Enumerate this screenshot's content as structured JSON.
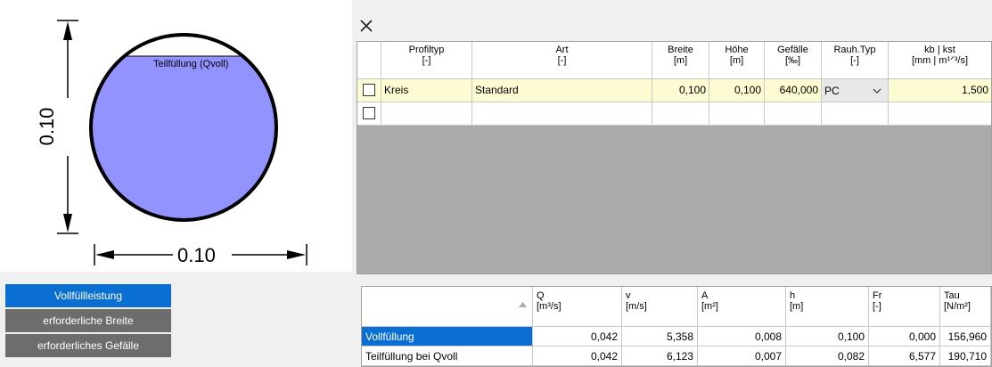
{
  "drawing": {
    "fill_label": "Teilfüllung (Qvoll)",
    "dim_vertical": "0.10",
    "dim_horizontal": "0.10",
    "fill_color": "#9393ff"
  },
  "menu": [
    {
      "label": "Vollfüllleistung",
      "active": true
    },
    {
      "label": "erforderliche Breite",
      "active": false
    },
    {
      "label": "erforderliches Gefälle",
      "active": false
    }
  ],
  "profile_table": {
    "headers": [
      {
        "label": "Profiltyp",
        "unit": "[-]"
      },
      {
        "label": "Art",
        "unit": "[-]"
      },
      {
        "label": "Breite",
        "unit": "[m]"
      },
      {
        "label": "Höhe",
        "unit": "[m]"
      },
      {
        "label": "Gefälle",
        "unit": "[‰]"
      },
      {
        "label": "Rauh.Typ",
        "unit": "[-]"
      },
      {
        "label": "kb | kst",
        "unit": "[mm | m¹ᐟ³/s]"
      }
    ],
    "row": {
      "profiltyp": "Kreis",
      "art": "Standard",
      "breite": "0,100",
      "hoehe": "0,100",
      "gefaelle": "640,000",
      "rauh_typ": "PC",
      "kb_kst": "1,500"
    }
  },
  "result_table": {
    "headers": [
      {
        "label": "Q",
        "unit": "[m³/s]"
      },
      {
        "label": "v",
        "unit": "[m/s]"
      },
      {
        "label": "A",
        "unit": "[m²]"
      },
      {
        "label": "h",
        "unit": "[m]"
      },
      {
        "label": "Fr",
        "unit": "[-]"
      },
      {
        "label": "Tau",
        "unit": "[N/m²]"
      }
    ],
    "rows": [
      {
        "label": "Vollfüllung",
        "values": [
          "0,042",
          "5,358",
          "0,008",
          "0,100",
          "0,000",
          "156,960"
        ]
      },
      {
        "label": "Teilfüllung bei Qvoll",
        "values": [
          "0,042",
          "6,123",
          "0,007",
          "0,082",
          "6,577",
          "190,710"
        ]
      }
    ]
  }
}
